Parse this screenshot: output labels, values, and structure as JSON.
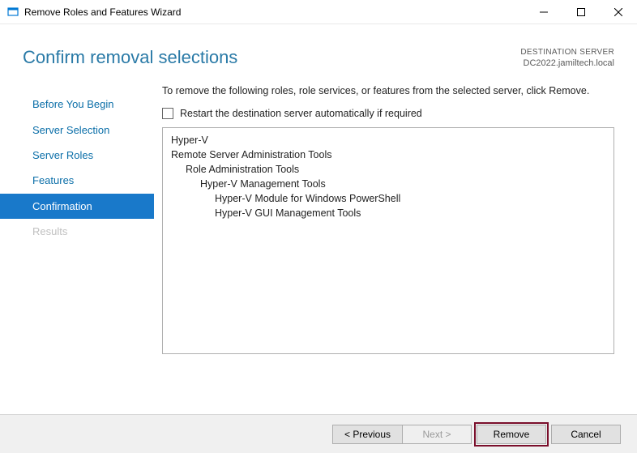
{
  "window": {
    "title": "Remove Roles and Features Wizard"
  },
  "header": {
    "title": "Confirm removal selections",
    "destination_label": "DESTINATION SERVER",
    "destination_value": "DC2022.jamiltech.local"
  },
  "sidebar": {
    "items": [
      {
        "label": "Before You Begin",
        "state": "normal"
      },
      {
        "label": "Server Selection",
        "state": "normal"
      },
      {
        "label": "Server Roles",
        "state": "normal"
      },
      {
        "label": "Features",
        "state": "normal"
      },
      {
        "label": "Confirmation",
        "state": "active"
      },
      {
        "label": "Results",
        "state": "disabled"
      }
    ]
  },
  "content": {
    "instruction": "To remove the following roles, role services, or features from the selected server, click Remove.",
    "restart_checkbox_label": "Restart the destination server automatically if required",
    "restart_checked": false,
    "removal_items": [
      {
        "text": "Hyper-V",
        "indent": 0
      },
      {
        "text": "Remote Server Administration Tools",
        "indent": 0
      },
      {
        "text": "Role Administration Tools",
        "indent": 1
      },
      {
        "text": "Hyper-V Management Tools",
        "indent": 2
      },
      {
        "text": "Hyper-V Module for Windows PowerShell",
        "indent": 3
      },
      {
        "text": "Hyper-V GUI Management Tools",
        "indent": 3
      }
    ]
  },
  "footer": {
    "previous": "< Previous",
    "next": "Next >",
    "install": "Remove",
    "cancel": "Cancel"
  }
}
